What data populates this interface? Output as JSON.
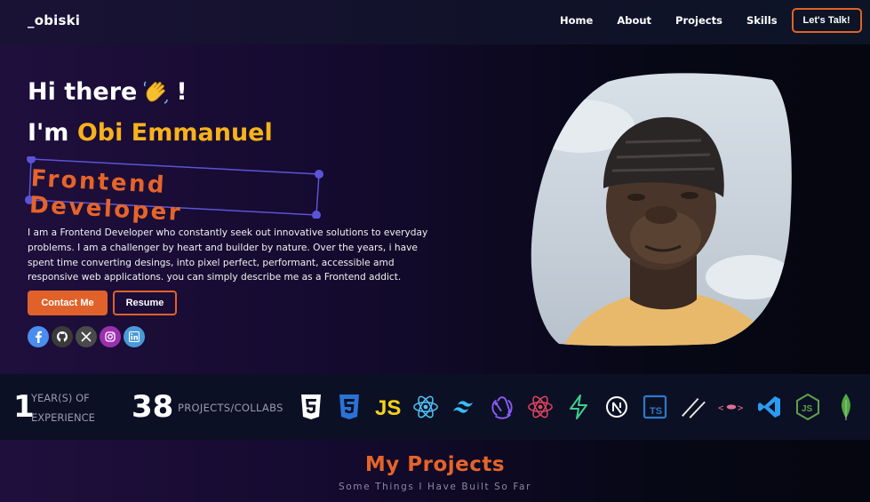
{
  "nav": {
    "logo": "_obiski",
    "links": [
      "Home",
      "About",
      "Projects",
      "Skills"
    ],
    "cta": "Let's Talk!"
  },
  "hero": {
    "greeting": "Hi there",
    "greeting_suffix": "!",
    "greeting_icon": "waving-hand-icon",
    "im_prefix": "I'm",
    "name": "Obi Emmanuel",
    "role": "Frontend Developer",
    "bio": "I am a Frontend Developer who constantly seek out innovative solutions to everyday problems. I am a challenger by heart and builder by nature. Over the years, i have spent time converting desings, into pixel perfect, performant, accessible amd responsive web applications. you can simply describe me as a Frontend addict.",
    "contact_button": "Contact Me",
    "resume_button": "Resume",
    "socials": [
      {
        "icon": "facebook-icon",
        "color": "#1877f2"
      },
      {
        "icon": "github-icon",
        "color": "#3a3a3a"
      },
      {
        "icon": "x-icon",
        "color": "#4a4a4a"
      },
      {
        "icon": "instagram-icon",
        "color": "#9b2fae"
      },
      {
        "icon": "linkedin-icon",
        "color": "#4b9ad8"
      }
    ]
  },
  "stats": {
    "experience_value": "1",
    "experience_label_line1": "YEAR(S) OF",
    "experience_label_line2": "EXPERIENCE",
    "projects_value": "38",
    "projects_label": "PROJECTS/COLLABS",
    "tech_icons": [
      "html5-icon",
      "css3-icon",
      "javascript-icon",
      "react-icon",
      "tailwind-icon",
      "redux-icon",
      "react-native-icon",
      "supabase-icon",
      "nextjs-icon",
      "typescript-icon",
      "slash-icon",
      "styled-components-icon",
      "vscode-icon",
      "nodejs-icon",
      "mongodb-icon"
    ]
  },
  "projects": {
    "title": "My Projects",
    "subtitle": "Some Things I Have Built So Far"
  },
  "colors": {
    "accent": "#e0622a",
    "name_yellow": "#f7b21a",
    "frame_purple": "#5a55d6"
  }
}
